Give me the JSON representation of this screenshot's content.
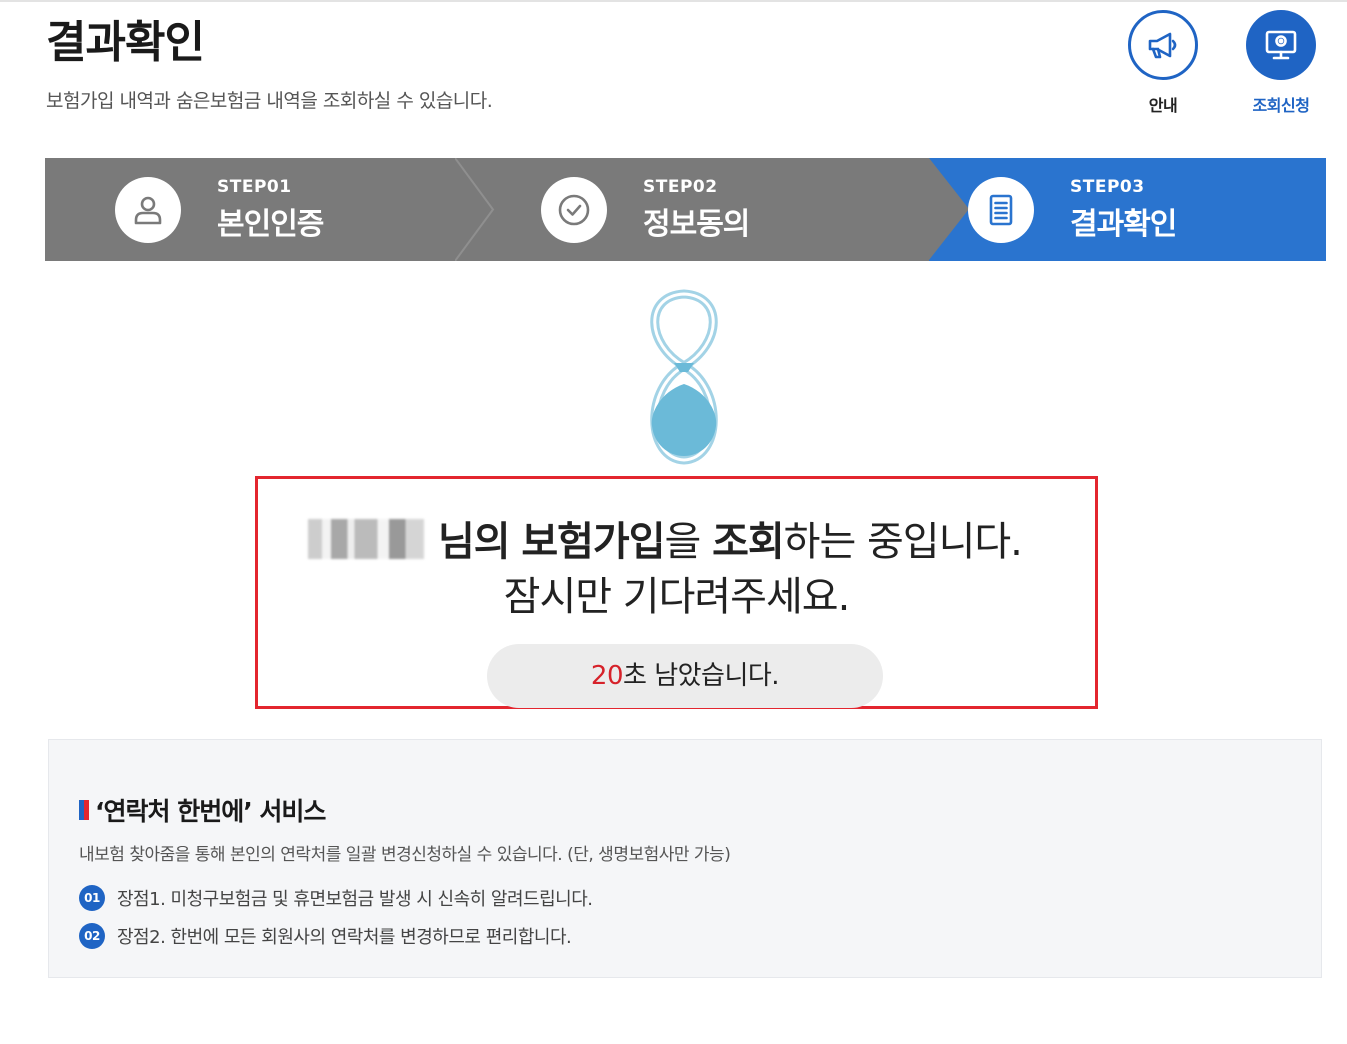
{
  "header": {
    "title": "결과확인",
    "subtitle": "보험가입 내역과 숨은보험금 내역을 조회하실 수 있습니다."
  },
  "shortcuts": [
    {
      "label": "안내",
      "icon": "megaphone-icon"
    },
    {
      "label": "조회신청",
      "icon": "monitor-search-icon"
    }
  ],
  "steps": [
    {
      "num": "STEP01",
      "name": "본인인증",
      "icon": "person-icon",
      "active": false
    },
    {
      "num": "STEP02",
      "name": "정보동의",
      "icon": "check-circle-icon",
      "active": false
    },
    {
      "num": "STEP03",
      "name": "결과확인",
      "icon": "document-icon",
      "active": true
    }
  ],
  "status": {
    "suffix": "님의",
    "bold1": "보험가입",
    "mid1": "을",
    "bold2": "조회",
    "end": "하는 중입니다.",
    "line2": "잠시만 기다려주세요.",
    "seconds": "20",
    "seconds_suffix": "초 남았습니다."
  },
  "service": {
    "title": "‘연락처 한번에’ 서비스",
    "description": "내보험 찾아줌을 통해 본인의 연락처를 일괄 변경신청하실 수 있습니다. (단, 생명보험사만 가능)",
    "items": [
      {
        "badge": "01",
        "text": "장점1. 미청구보험금 및 휴면보험금 발생 시 신속히 알려드립니다."
      },
      {
        "badge": "02",
        "text": "장점2. 한번에 모든 회원사의 연락처를 변경하므로 편리합니다."
      }
    ]
  },
  "colors": {
    "accent": "#2a74cf",
    "step_inactive": "#7a7a7a",
    "alert_border": "#e3262f",
    "hourglass": "#6bbad8"
  }
}
